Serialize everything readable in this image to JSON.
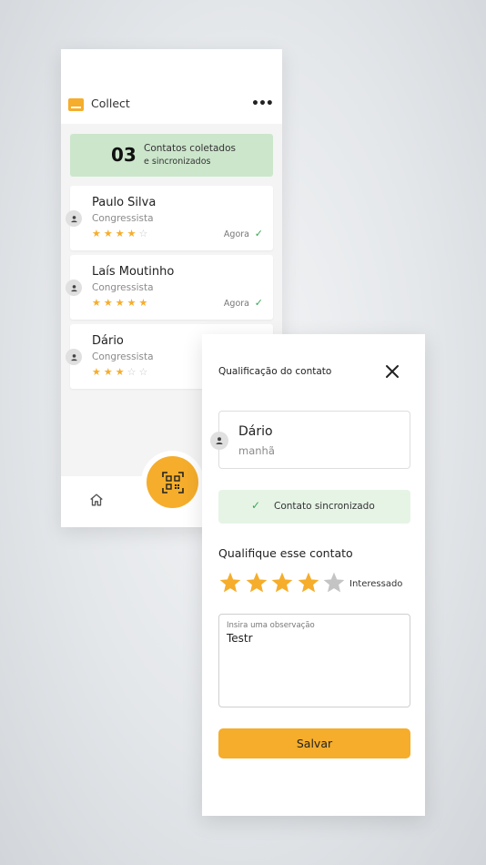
{
  "colors": {
    "accent": "#f5ad2b",
    "success_bg": "#cce6cc",
    "success_check": "#3aa856",
    "synced_bg": "#e6f4e6"
  },
  "list_screen": {
    "app_title": "Collect",
    "more_icon": "more-horizontal-icon",
    "summary": {
      "count": "03",
      "line1": "Contatos coletados",
      "line2": "e sincronizados"
    },
    "contacts": [
      {
        "name": "Paulo Silva",
        "role": "Congressista",
        "rating": 4,
        "max": 5,
        "time": "Agora",
        "synced": true
      },
      {
        "name": "Laís Moutinho",
        "role": "Congressista",
        "rating": 5,
        "max": 5,
        "time": "Agora",
        "synced": true
      },
      {
        "name": "Dário",
        "role": "Congressista",
        "rating": 3,
        "max": 5,
        "time": "",
        "synced": false
      }
    ],
    "nav": {
      "home_icon": "home-icon",
      "scan_icon": "qr-scan-icon"
    }
  },
  "qualify_screen": {
    "title": "Qualificação do contato",
    "close_icon": "close-icon",
    "contact_name": "Dário",
    "contact_sub": "manhã",
    "sync_status": "Contato sincronizado",
    "heading": "Qualifique esse contato",
    "rating": 4,
    "rating_max": 5,
    "rating_label": "Interessado",
    "observation_placeholder": "Insira uma observação",
    "observation_value": "Testr",
    "save_label": "Salvar"
  }
}
